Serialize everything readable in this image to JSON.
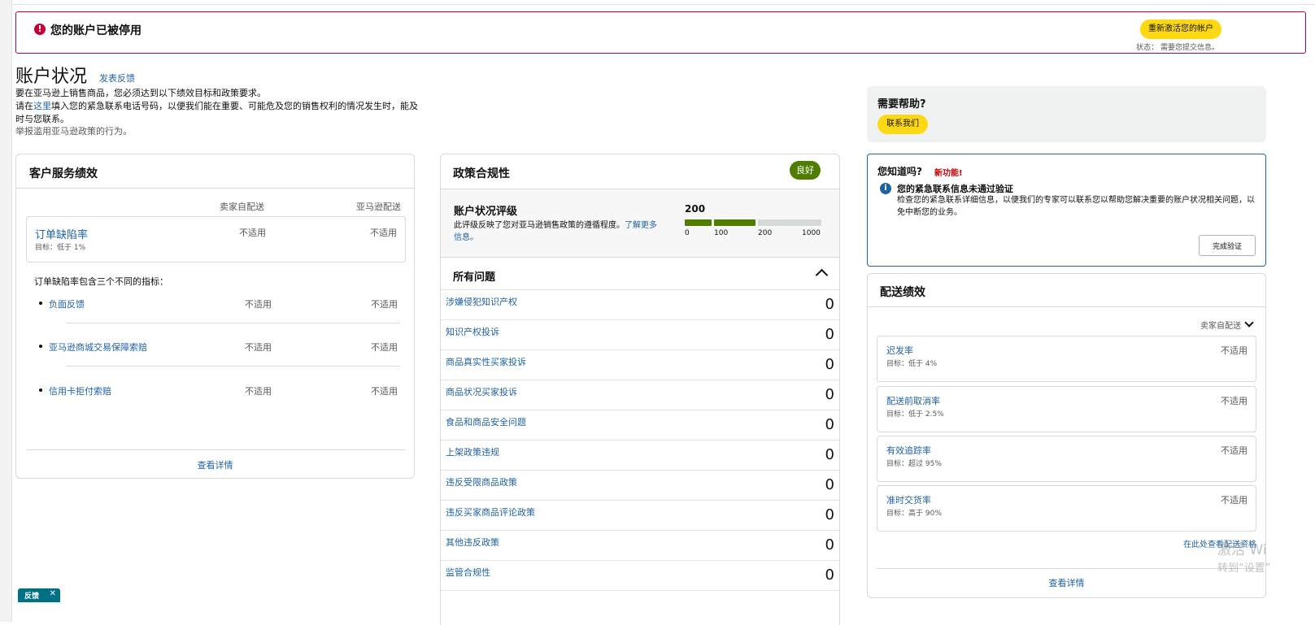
{
  "alert": {
    "title": "您的账户已被停用",
    "icon": "alert-icon",
    "reactivate_button": "重新激活您的帐户",
    "status_text": "状态：   需要您提交信息。"
  },
  "header": {
    "title": "账户状况",
    "feedback_link": "发表反馈",
    "intro_line1": "要在亚马逊上销售商品，您必须达到以下绩效目标和政策要求。",
    "intro_pre_link": "请在",
    "intro_link": "这里",
    "intro_post_link": "填入您的紧急联系电话号码，以便我们能在重要、可能危及您的销售权利的情况发生时，能及时与您联系。",
    "report_abuse": "举报滥用亚马逊政策的行为。"
  },
  "customer_service": {
    "title": "客户服务绩效",
    "col_seller": "卖家自配送",
    "col_amazon": "亚马逊配送",
    "odr": {
      "name": "订单缺陷率",
      "target": "目标：低于 1%",
      "seller": "不适用",
      "amazon": "不适用"
    },
    "note": "订单缺陷率包含三个不同的指标：",
    "metrics": [
      {
        "name": "负面反馈",
        "seller": "不适用",
        "amazon": "不适用"
      },
      {
        "name": "亚马逊商城交易保障索赔",
        "seller": "不适用",
        "amazon": "不适用"
      },
      {
        "name": "信用卡拒付索赔",
        "seller": "不适用",
        "amazon": "不适用"
      }
    ],
    "view_details": "查看详情"
  },
  "policy": {
    "title": "政策合规性",
    "badge": "良好",
    "badge_color": "#4e7d00",
    "ahr_title": "账户状况评级",
    "ahr_desc": "此评级反映了您对亚马逊销售政策的遵循程度。",
    "ahr_link": "了解更多信息。",
    "ahr_score": "200",
    "ahr_score_value": 200,
    "ahr_ticks": [
      "0",
      "100",
      "200",
      "1000"
    ],
    "issues_title": "所有问题",
    "issues": [
      {
        "name": "涉嫌侵犯知识产权",
        "count": "0"
      },
      {
        "name": "知识产权投诉",
        "count": "0"
      },
      {
        "name": "商品真实性买家投诉",
        "count": "0"
      },
      {
        "name": "商品状况买家投诉",
        "count": "0"
      },
      {
        "name": "食品和商品安全问题",
        "count": "0"
      },
      {
        "name": "上架政策违规",
        "count": "0"
      },
      {
        "name": "违反受限商品政策",
        "count": "0"
      },
      {
        "name": "违反买家商品评论政策",
        "count": "0"
      },
      {
        "name": "其他违反政策",
        "count": "0"
      },
      {
        "name": "监管合规性",
        "count": "0"
      }
    ]
  },
  "help": {
    "title": "需要帮助?",
    "contact_button": "联系我们"
  },
  "did_you_know": {
    "title": "您知道吗?",
    "new_label": "新功能!",
    "message_title": "您的紧急联系信息未通过验证",
    "message_body": "检查您的紧急联系详细信息，以便我们的专家可以联系您以帮助您解决重要的账户状况相关问题，以免中断您的业务。",
    "button": "完成验证"
  },
  "shipping": {
    "title": "配送绩效",
    "selector": "卖家自配送",
    "metrics": [
      {
        "name": "迟发率",
        "target": "目标：低于 4%",
        "value": "不适用"
      },
      {
        "name": "配送前取消率",
        "target": "目标：低于 2.5%",
        "value": "不适用"
      },
      {
        "name": "有效追踪率",
        "target": "目标：超过 95%",
        "value": "不适用"
      },
      {
        "name": "准时交货率",
        "target": "目标：高于 90%",
        "value": "不适用"
      }
    ],
    "eligibility_link": "在此处查看配送资格",
    "view_details": "查看详情"
  },
  "watermark": {
    "line1": "激活 Wi",
    "line2": "转到“设置”"
  },
  "feedback_tab": {
    "label": "反馈",
    "close": "✕"
  },
  "colors": {
    "alert": "#c40035",
    "link": "#2162a1",
    "button_yellow": "#ffd814",
    "good_green": "#4e7d00"
  }
}
